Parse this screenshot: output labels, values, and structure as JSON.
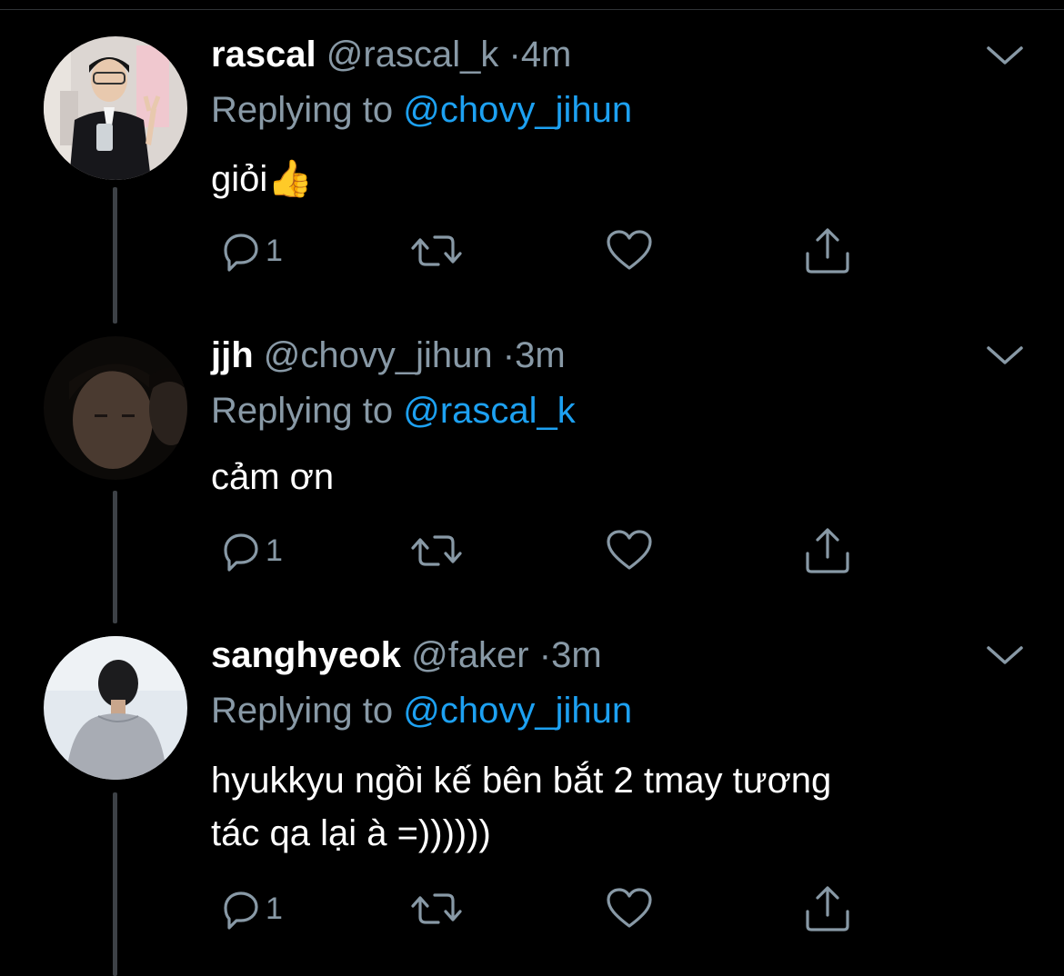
{
  "tweets": [
    {
      "name": "rascal",
      "handle": "@rascal_k",
      "dot": "·",
      "time": "4m",
      "replying_prefix": "Replying to",
      "replying_to": "@chovy_jihun",
      "text_lines": [
        "giỏi👍"
      ],
      "reply_count": "1"
    },
    {
      "name": "jjh",
      "handle": "@chovy_jihun",
      "dot": "·",
      "time": "3m",
      "replying_prefix": "Replying to",
      "replying_to": "@rascal_k",
      "text_lines": [
        "cảm ơn"
      ],
      "reply_count": "1"
    },
    {
      "name": "sanghyeok",
      "handle": "@faker",
      "dot": "·",
      "time": "3m",
      "replying_prefix": "Replying to",
      "replying_to": "@chovy_jihun",
      "text_lines": [
        "hyukkyu ngồi kế bên bắt 2 tmay tương",
        "tác qa lại à =))))))"
      ],
      "reply_count": "1"
    }
  ],
  "icons": {
    "caret": "chevron-down-icon",
    "reply": "reply-icon",
    "retweet": "retweet-icon",
    "like": "heart-icon",
    "share": "share-icon"
  },
  "colors": {
    "background": "#000000",
    "secondary_text": "#8899a6",
    "mention": "#1da1f2",
    "thread_line": "#3d4146"
  }
}
